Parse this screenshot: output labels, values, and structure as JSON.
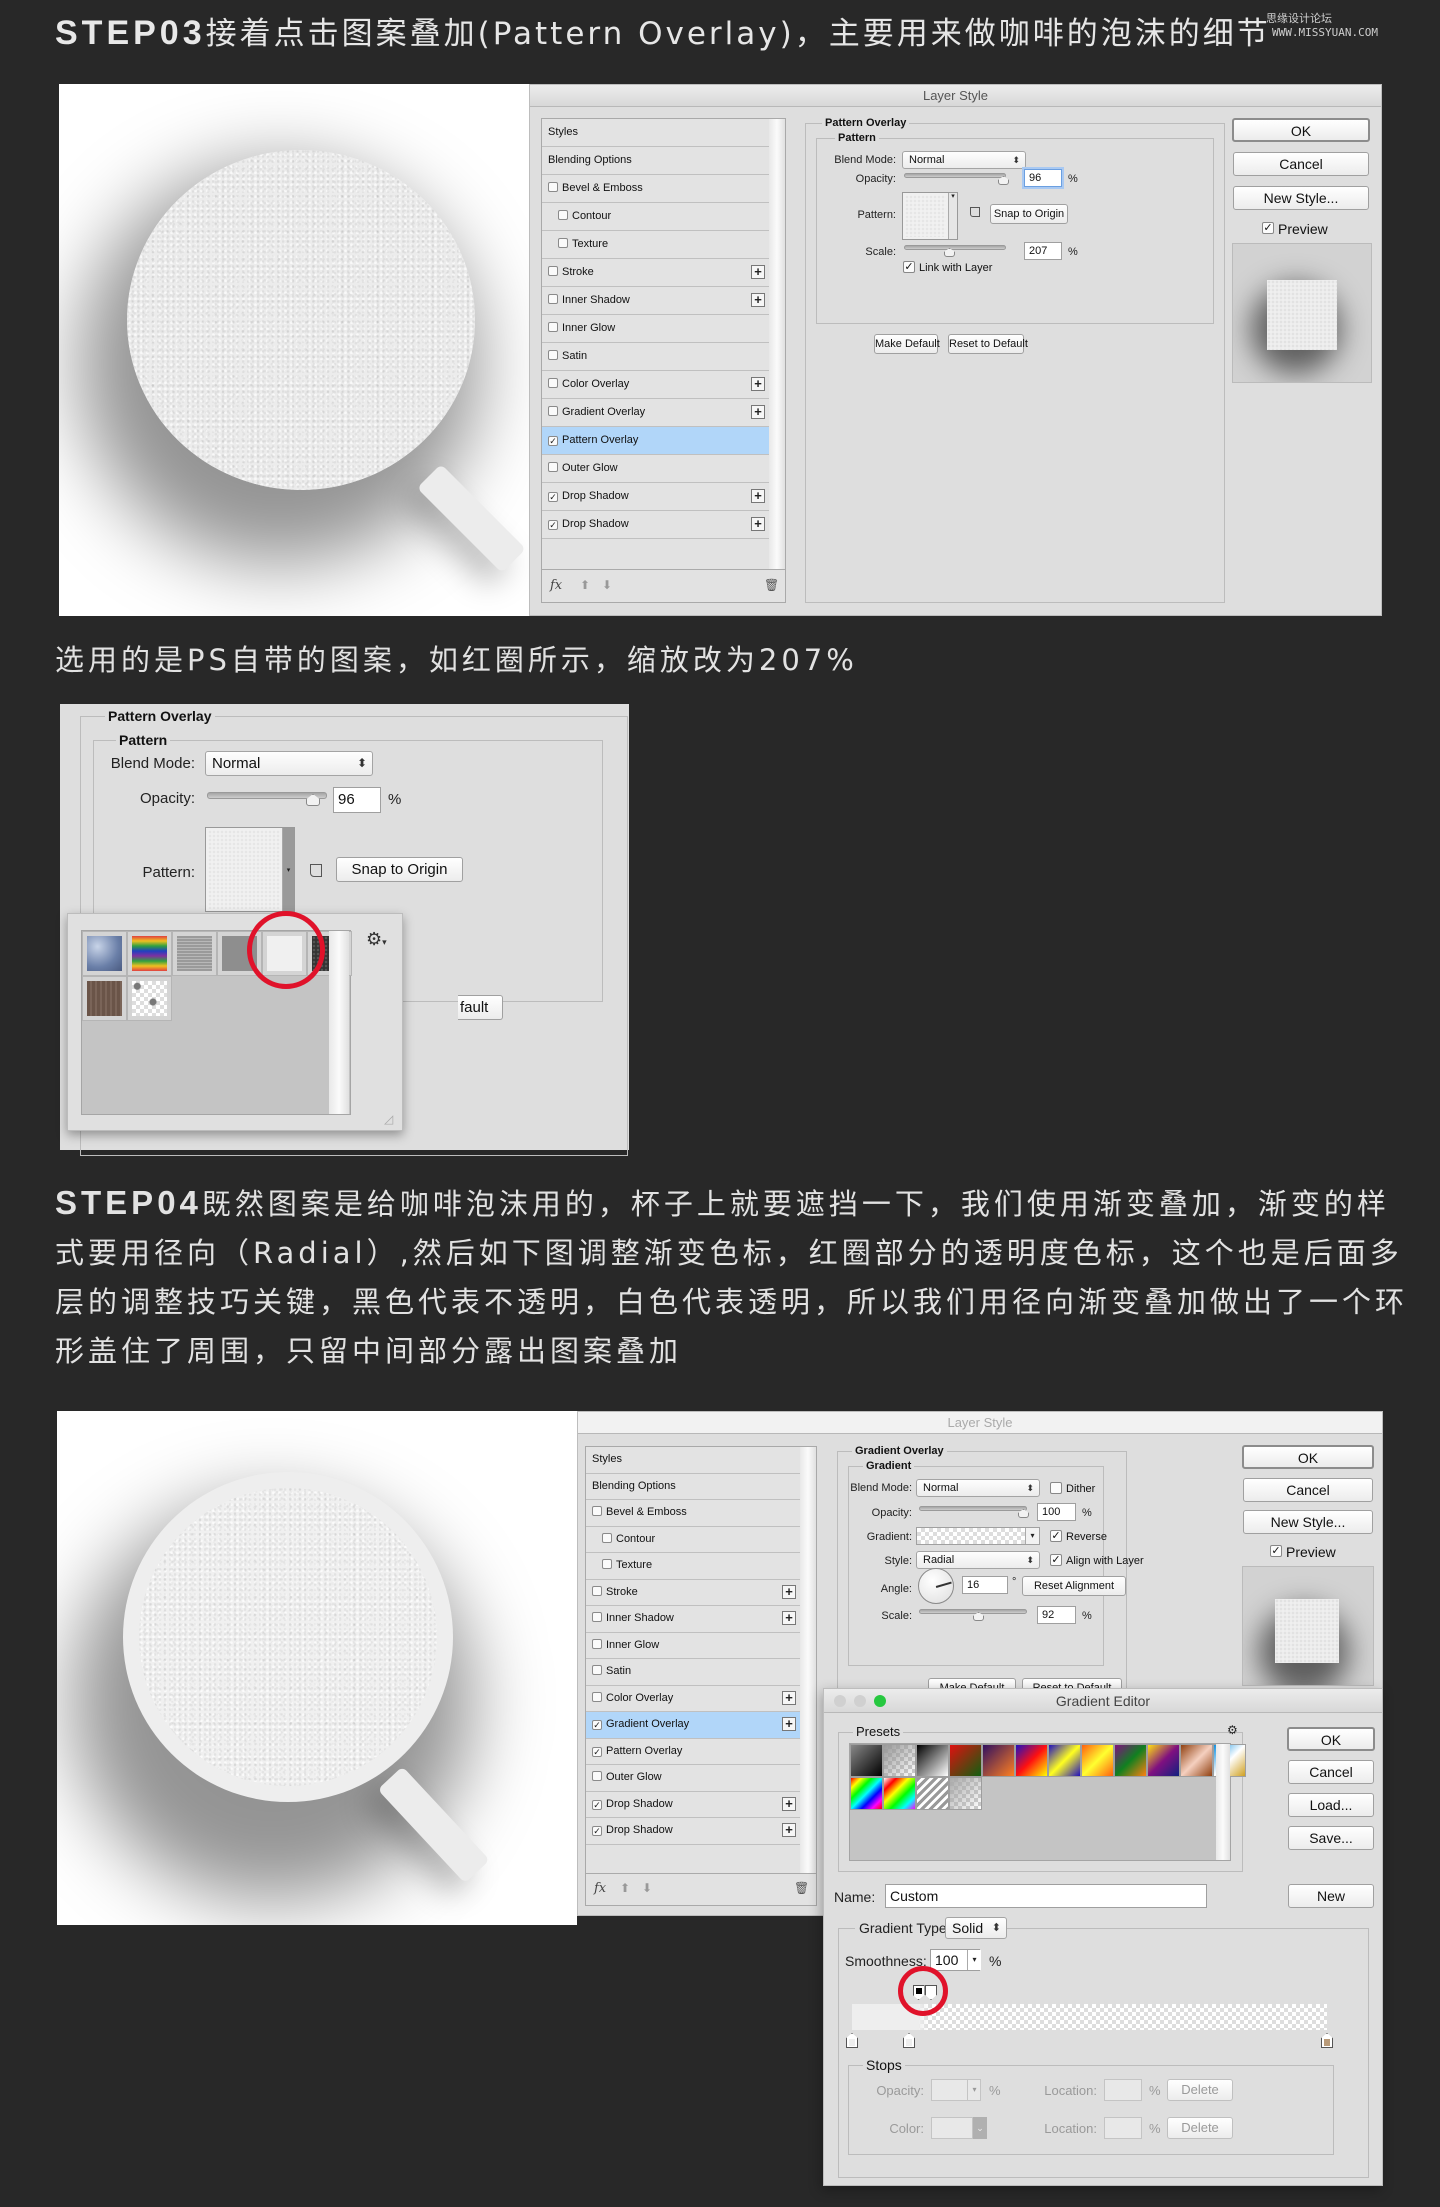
{
  "watermark": {
    "site_cn": "思缘设计论坛",
    "site_url": "WWW.MISSYUAN.COM"
  },
  "step03": {
    "label": "STEP03",
    "text": "接着点击图案叠加(Pattern Overlay)，主要用来做咖啡的泡沫的细节"
  },
  "dialog1": {
    "title": "Layer Style",
    "styles_list": [
      {
        "label": "Styles",
        "checkbox": null,
        "plus": false,
        "indent": false,
        "selected": false
      },
      {
        "label": "Blending Options",
        "checkbox": null,
        "plus": false,
        "indent": false,
        "selected": false
      },
      {
        "label": "Bevel & Emboss",
        "checkbox": false,
        "plus": false,
        "indent": false,
        "selected": false
      },
      {
        "label": "Contour",
        "checkbox": false,
        "plus": false,
        "indent": true,
        "selected": false
      },
      {
        "label": "Texture",
        "checkbox": false,
        "plus": false,
        "indent": true,
        "selected": false
      },
      {
        "label": "Stroke",
        "checkbox": false,
        "plus": true,
        "indent": false,
        "selected": false
      },
      {
        "label": "Inner Shadow",
        "checkbox": false,
        "plus": true,
        "indent": false,
        "selected": false
      },
      {
        "label": "Inner Glow",
        "checkbox": false,
        "plus": false,
        "indent": false,
        "selected": false
      },
      {
        "label": "Satin",
        "checkbox": false,
        "plus": false,
        "indent": false,
        "selected": false
      },
      {
        "label": "Color Overlay",
        "checkbox": false,
        "plus": true,
        "indent": false,
        "selected": false
      },
      {
        "label": "Gradient Overlay",
        "checkbox": false,
        "plus": true,
        "indent": false,
        "selected": false
      },
      {
        "label": "Pattern Overlay",
        "checkbox": true,
        "plus": false,
        "indent": false,
        "selected": true
      },
      {
        "label": "Outer Glow",
        "checkbox": false,
        "plus": false,
        "indent": false,
        "selected": false
      },
      {
        "label": "Drop Shadow",
        "checkbox": true,
        "plus": true,
        "indent": false,
        "selected": false
      },
      {
        "label": "Drop Shadow",
        "checkbox": true,
        "plus": true,
        "indent": false,
        "selected": false
      }
    ],
    "fx_label": "fx",
    "section_title": "Pattern Overlay",
    "group_title": "Pattern",
    "blend_mode_label": "Blend Mode:",
    "blend_mode_value": "Normal",
    "opacity_label": "Opacity:",
    "opacity_value": "96",
    "opacity_fraction": 0.96,
    "percent": "%",
    "pattern_label": "Pattern:",
    "snap_button": "Snap to Origin",
    "scale_label": "Scale:",
    "scale_value": "207",
    "scale_slider_fraction": 0.55,
    "link_label": "Link with Layer",
    "link_checked": true,
    "make_default": "Make Default",
    "reset_default": "Reset to Default",
    "ok": "OK",
    "cancel": "Cancel",
    "new_style": "New Style...",
    "preview_label": "Preview",
    "preview_checked": true
  },
  "caption1": "选用的是PS自带的图案，如红圈所示，缩放改为207%",
  "crop": {
    "section_title": "Pattern Overlay",
    "group_title": "Pattern",
    "blend_mode_label": "Blend Mode:",
    "blend_mode_value": "Normal",
    "opacity_label": "Opacity:",
    "opacity_value": "96",
    "percent": "%",
    "pattern_label": "Pattern:",
    "snap_button": "Snap to Origin",
    "partial_button": "fault",
    "patterns": [
      "Bubbles",
      "Tie Dye",
      "Laid-Horizontal",
      "Fibers",
      "Light Noise (selected)",
      "Dark Mesh",
      "Wood",
      "Transparent Dots"
    ]
  },
  "step04": {
    "label": "STEP04",
    "text": "既然图案是给咖啡泡沫用的，杯子上就要遮挡一下，我们使用渐变叠加，渐变的样式要用径向（Radial）,然后如下图调整渐变色标，红圈部分的透明度色标，这个也是后面多层的调整技巧关键，黑色代表不透明，白色代表透明，所以我们用径向渐变叠加做出了一个环形盖住了周围，只留中间部分露出图案叠加"
  },
  "dialog2": {
    "title": "Layer Style",
    "styles_list": [
      {
        "label": "Styles",
        "checkbox": null,
        "plus": false,
        "indent": false,
        "selected": false
      },
      {
        "label": "Blending Options",
        "checkbox": null,
        "plus": false,
        "indent": false,
        "selected": false
      },
      {
        "label": "Bevel & Emboss",
        "checkbox": false,
        "plus": false,
        "indent": false,
        "selected": false
      },
      {
        "label": "Contour",
        "checkbox": false,
        "plus": false,
        "indent": true,
        "selected": false
      },
      {
        "label": "Texture",
        "checkbox": false,
        "plus": false,
        "indent": true,
        "selected": false
      },
      {
        "label": "Stroke",
        "checkbox": false,
        "plus": true,
        "indent": false,
        "selected": false
      },
      {
        "label": "Inner Shadow",
        "checkbox": false,
        "plus": true,
        "indent": false,
        "selected": false
      },
      {
        "label": "Inner Glow",
        "checkbox": false,
        "plus": false,
        "indent": false,
        "selected": false
      },
      {
        "label": "Satin",
        "checkbox": false,
        "plus": false,
        "indent": false,
        "selected": false
      },
      {
        "label": "Color Overlay",
        "checkbox": false,
        "plus": true,
        "indent": false,
        "selected": false
      },
      {
        "label": "Gradient Overlay",
        "checkbox": true,
        "plus": true,
        "indent": false,
        "selected": true
      },
      {
        "label": "Pattern Overlay",
        "checkbox": true,
        "plus": false,
        "indent": false,
        "selected": false
      },
      {
        "label": "Outer Glow",
        "checkbox": false,
        "plus": false,
        "indent": false,
        "selected": false
      },
      {
        "label": "Drop Shadow",
        "checkbox": true,
        "plus": true,
        "indent": false,
        "selected": false
      },
      {
        "label": "Drop Shadow",
        "checkbox": true,
        "plus": true,
        "indent": false,
        "selected": false
      }
    ],
    "fx_label": "fx",
    "section_title": "Gradient Overlay",
    "group_title": "Gradient",
    "blend_mode_label": "Blend Mode:",
    "blend_mode_value": "Normal",
    "dither_label": "Dither",
    "dither_checked": false,
    "opacity_label": "Opacity:",
    "opacity_value": "100",
    "opacity_fraction": 1.0,
    "percent": "%",
    "gradient_label": "Gradient:",
    "reverse_label": "Reverse",
    "reverse_checked": true,
    "style_label": "Style:",
    "style_value": "Radial",
    "align_label": "Align with Layer",
    "align_checked": true,
    "angle_label": "Angle:",
    "angle_value": "16",
    "degree": "°",
    "reset_alignment": "Reset Alignment",
    "scale_label": "Scale:",
    "scale_value": "92",
    "scale_slider_fraction": 0.55,
    "make_default": "Make Default",
    "reset_default": "Reset to Default",
    "ok": "OK",
    "cancel": "Cancel",
    "new_style": "New Style...",
    "preview_label": "Preview",
    "preview_checked": true
  },
  "gradient_editor": {
    "title": "Gradient Editor",
    "presets_label": "Presets",
    "ok": "OK",
    "cancel": "Cancel",
    "load": "Load...",
    "save": "Save...",
    "name_label": "Name:",
    "name_value": "Custom",
    "new_button": "New",
    "type_label": "Gradient Type:",
    "type_value": "Solid",
    "smoothness_label": "Smoothness:",
    "smoothness_value": "100",
    "percent": "%",
    "stops_title": "Stops",
    "opacity_label": "Opacity:",
    "color_label": "Color:",
    "location_label": "Location:",
    "delete_button": "Delete",
    "opacity_stops": [
      {
        "location_pct": 14,
        "color": "#000000"
      },
      {
        "location_pct": 16,
        "color": "#ffffff"
      }
    ],
    "color_stops": [
      {
        "location_pct": 0,
        "color": "#eeeeee"
      },
      {
        "location_pct": 12,
        "color": "#eeeeee"
      },
      {
        "location_pct": 100,
        "color": "#b89a78"
      }
    ],
    "preset_colors": [
      [
        "#888",
        "#000"
      ],
      [
        "#999",
        "rgba(255,255,255,0)"
      ],
      [
        "#000",
        "#fff"
      ],
      [
        "#e01010",
        "#106010"
      ],
      [
        "#301060",
        "#ff8020"
      ],
      [
        "#2010c0",
        "#ff1010",
        "#ffff00"
      ],
      [
        "#2010c0",
        "#ffff20",
        "#2010c0"
      ],
      [
        "#ff6010",
        "#ffff30",
        "#ff6010"
      ],
      [
        "#801080",
        "#108020",
        "#ff8010"
      ],
      [
        "#ffe010",
        "#801080",
        "#102080"
      ],
      [
        "#904010",
        "#f5d0c0",
        "#904010"
      ],
      [
        "#1090e0",
        "#ffffff",
        "#d0a020"
      ],
      [
        "#ff0000",
        "#ffff00",
        "#00ff00",
        "#00ffff",
        "#0000ff",
        "#ff00ff",
        "#ff0000"
      ],
      [
        "#ffffff",
        "#ff0000",
        "#ffff00",
        "#00ff00",
        "#00ffff",
        "#ff00ff"
      ],
      [
        "#999",
        "#fff",
        "#999",
        "#fff"
      ],
      [
        "#aaa",
        "rgba(255,255,255,0)"
      ]
    ]
  },
  "colors": {
    "page_bg": "#282828",
    "selection_blue": "#b1d6f9",
    "red_circle": "#e0122a",
    "mac_green": "#27c840"
  }
}
